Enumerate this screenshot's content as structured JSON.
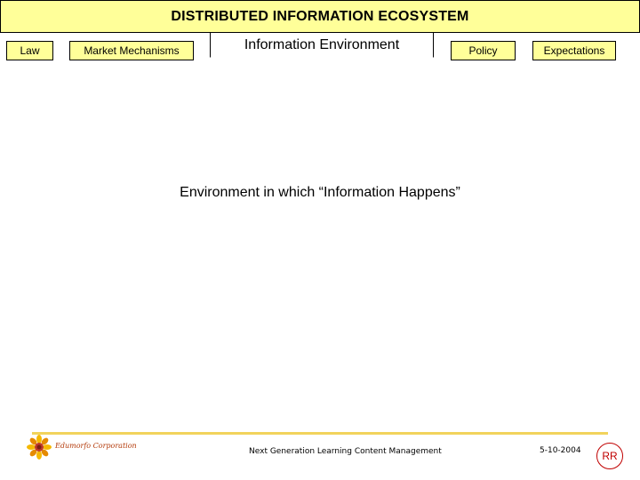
{
  "header": {
    "title": "DISTRIBUTED INFORMATION ECOSYSTEM"
  },
  "tabs": {
    "law": "Law",
    "market_mechanisms": "Market Mechanisms",
    "information_environment": "Information Environment",
    "policy": "Policy",
    "expectations": "Expectations"
  },
  "content": {
    "text": "Environment in which “Information Happens”"
  },
  "footer": {
    "company": "Edumorfo Corporation",
    "center_text": "Next Generation Learning Content Management",
    "date": "5-10-2004",
    "badge": "RR"
  },
  "colors": {
    "panel": "#ffff99",
    "footer_rule": "#f2d35c",
    "badge": "#c00000",
    "company_text": "#b43c0c"
  },
  "icons": {
    "logo": "sunflower-logo-icon"
  }
}
